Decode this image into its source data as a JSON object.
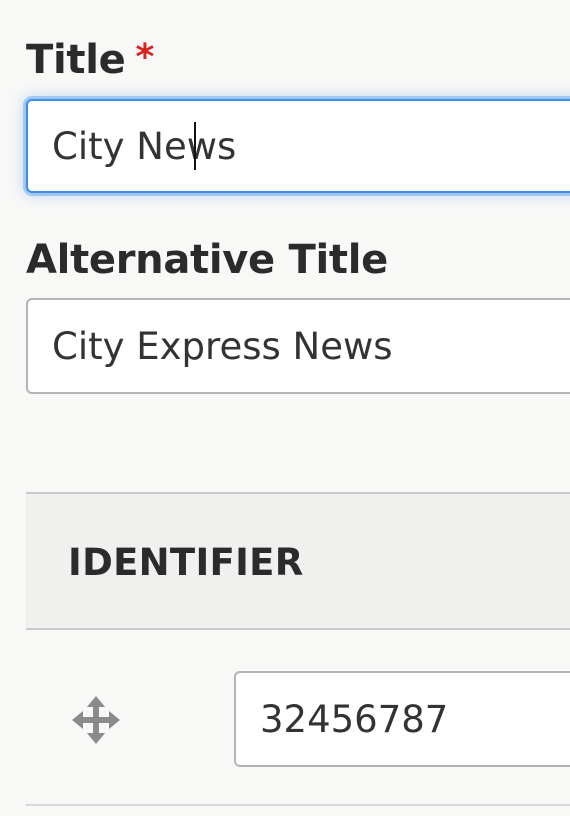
{
  "form": {
    "title_field": {
      "label": "Title",
      "required_marker": "*",
      "value": "City News"
    },
    "alternative_title_field": {
      "label": "Alternative Title",
      "value": "City Express News"
    },
    "identifier_table": {
      "header": "IDENTIFIER",
      "rows": [
        {
          "value": "32456787",
          "handle_icon": "move-handle-icon"
        }
      ]
    }
  },
  "colors": {
    "required": "#d72222",
    "focus": "#3d8fe5",
    "border": "#b4b4b4",
    "header_bg": "#f0f0ee"
  }
}
